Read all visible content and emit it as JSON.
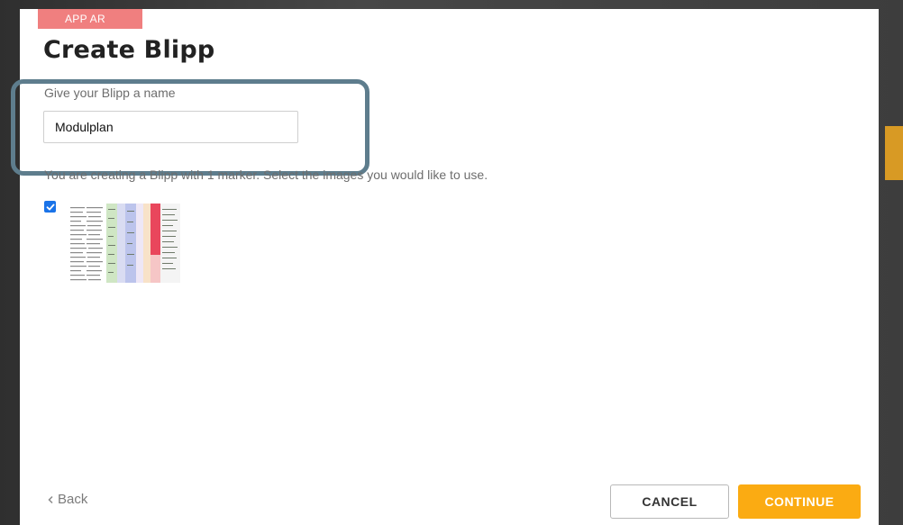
{
  "modal": {
    "tag": "APP AR",
    "title": "Create Blipp",
    "name_label": "Give your Blipp a name",
    "name_value": "Modulplan",
    "marker_description": "You are creating a Blipp with 1 marker. Select the images you would like to use.",
    "marker_checked": true,
    "marker_thumbnail_icon": "document-thumbnail-icon"
  },
  "footer": {
    "back_icon": "chevron-left-icon",
    "back_label": "Back",
    "cancel_label": "CANCEL",
    "continue_label": "CONTINUE"
  },
  "colors": {
    "tag_background": "#f07f7f",
    "highlight_border": "#5e7d8d",
    "checkbox": "#1a73e8",
    "continue_button": "#fbab12"
  }
}
